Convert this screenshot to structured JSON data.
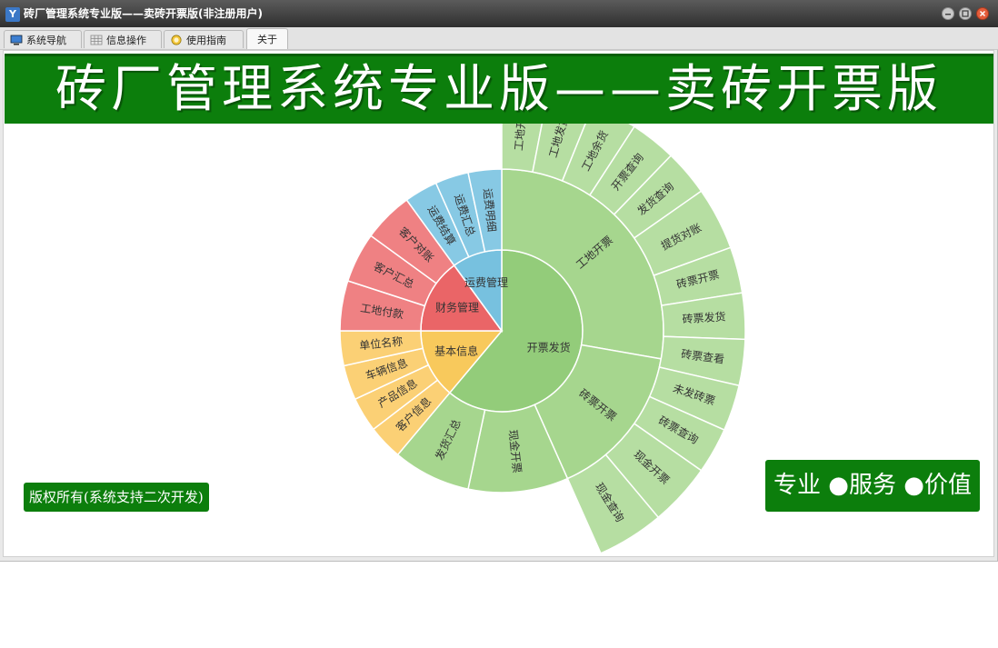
{
  "window": {
    "title": "砖厂管理系统专业版——卖砖开票版(非注册用户)",
    "app_icon_text": "Y"
  },
  "tabs": [
    {
      "label": "系统导航",
      "icon": "monitor-icon"
    },
    {
      "label": "信息操作",
      "icon": "grid-icon"
    },
    {
      "label": "使用指南",
      "icon": "help-globe-icon"
    },
    {
      "label": "关于",
      "icon": "",
      "active": true
    }
  ],
  "banner": {
    "title": "砖厂管理系统专业版——卖砖开票版"
  },
  "footer": {
    "copyright": "版权所有(系统支持二次开发)",
    "slogan": "专业 ●服务 ●价值"
  },
  "colors": {
    "banner_green": "#0c7e0c",
    "green_inner": "#93cc7a",
    "green_mid": "#a6d68e",
    "green_outer": "#b6dea2",
    "yellow_inner": "#f8c95c",
    "yellow_mid": "#fbd075",
    "red_inner": "#ea6567",
    "red_mid": "#ef8183",
    "blue_inner": "#77c1df",
    "blue_mid": "#87c9e4"
  },
  "chart_data": {
    "type": "sunburst",
    "rings": [
      {
        "level": 1,
        "segments": [
          {
            "label": "开票发货",
            "group": "green"
          },
          {
            "label": "基本信息",
            "group": "yellow"
          },
          {
            "label": "财务管理",
            "group": "red"
          },
          {
            "label": "运费管理",
            "group": "blue"
          }
        ]
      },
      {
        "level": 2,
        "segments": [
          {
            "label": "工地开票",
            "parent": "开票发货"
          },
          {
            "label": "砖票开票",
            "parent": "开票发货"
          },
          {
            "label": "现金开票",
            "parent": "开票发货"
          },
          {
            "label": "发货汇总",
            "parent": "开票发货"
          },
          {
            "label": "客户信息",
            "parent": "基本信息"
          },
          {
            "label": "产品信息",
            "parent": "基本信息"
          },
          {
            "label": "车辆信息",
            "parent": "基本信息"
          },
          {
            "label": "单位名称",
            "parent": "基本信息"
          },
          {
            "label": "工地付款",
            "parent": "财务管理"
          },
          {
            "label": "客户汇总",
            "parent": "财务管理"
          },
          {
            "label": "客户对账",
            "parent": "财务管理"
          },
          {
            "label": "运费结算",
            "parent": "运费管理"
          },
          {
            "label": "运费汇总",
            "parent": "运费管理"
          },
          {
            "label": "运费明细",
            "parent": "运费管理"
          }
        ]
      },
      {
        "level": 3,
        "segments": [
          {
            "label": "工地开票",
            "parent": "工地开票"
          },
          {
            "label": "工地发货",
            "parent": "工地开票"
          },
          {
            "label": "工地余货",
            "parent": "工地开票"
          },
          {
            "label": "开票查询",
            "parent": "工地开票"
          },
          {
            "label": "发货查询",
            "parent": "工地开票"
          },
          {
            "label": "提货对账",
            "parent": "工地开票"
          },
          {
            "label": "砖票开票",
            "parent": "砖票开票"
          },
          {
            "label": "砖票发货",
            "parent": "砖票开票"
          },
          {
            "label": "砖票查看",
            "parent": "砖票开票"
          },
          {
            "label": "未发砖票",
            "parent": "砖票开票"
          },
          {
            "label": "砖票查询",
            "parent": "砖票开票"
          },
          {
            "label": "现金开票",
            "parent": "现金开票"
          },
          {
            "label": "现金查询",
            "parent": "现金开票"
          }
        ]
      }
    ]
  }
}
